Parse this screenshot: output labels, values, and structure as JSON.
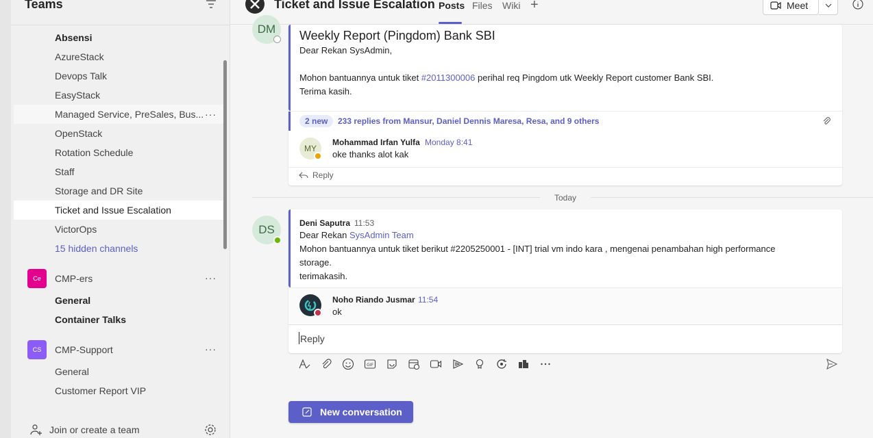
{
  "sidebar": {
    "title": "Teams",
    "channels_team1": [
      {
        "label": "Absensi",
        "bold": true
      },
      {
        "label": "AzureStack"
      },
      {
        "label": "Devops Talk"
      },
      {
        "label": "EasyStack"
      },
      {
        "label": "Managed Service, PreSales, Bus..."
      },
      {
        "label": "OpenStack"
      },
      {
        "label": "Rotation Schedule"
      },
      {
        "label": "Staff"
      },
      {
        "label": "Storage and DR Site"
      },
      {
        "label": "Ticket and Issue Escalation"
      },
      {
        "label": "VictorOps"
      },
      {
        "label": "15 hidden channels"
      }
    ],
    "team_cmp_ers": {
      "initials": "Ce",
      "name": "CMP-ers",
      "color": "#e3008c"
    },
    "cmp_ers_channels": [
      "General",
      "Container Talks"
    ],
    "team_cmp_support": {
      "initials": "CS",
      "name": "CMP-Support",
      "color": "#8b5cf6"
    },
    "cmp_support_channels": [
      "General",
      "Customer Report VIP"
    ],
    "join_label": "Join or create a team",
    "more": "···"
  },
  "header": {
    "channel_title": "Ticket and Issue Escalation",
    "tabs": {
      "posts": "Posts",
      "files": "Files",
      "wiki": "Wiki",
      "add": "+"
    },
    "meet_label": "Meet"
  },
  "thread1": {
    "avatar": "DM",
    "title": "Weekly Report (Pingdom) Bank SBI",
    "line1": "Dear Rekan SysAdmin,",
    "line2_pre": "Mohon bantuannya untuk tiket ",
    "line2_ticket": "#2011300006",
    "line2_post": " perihal req Pingdom utk Weekly Report customer Bank SBI.",
    "line3": "Terima kasih.",
    "new_badge": "2 new",
    "replies_summary": "233 replies from Mansur, Daniel Dennis Maresa, Resa, and 9 others",
    "reply_avatar": "MY",
    "reply_author": "Mohammad Irfan Yulfa",
    "reply_time": "Monday 8:41",
    "reply_text": "oke thanks alot kak",
    "reply_button": "Reply"
  },
  "day_separator": "Today",
  "thread2": {
    "avatar": "DS",
    "author": "Deni Saputra",
    "time": "11:53",
    "line1_pre": "Dear Rekan ",
    "line1_mention": "SysAdmin Team",
    "line2": "Mohon bantuannya untuk tiket berikut #2205250001 - [INT] trial vm indo kara , mengenai penambahan high performance",
    "line3": "storage.",
    "line4": "terimakasih.",
    "reply_author": "Noho Riando Jusmar",
    "reply_time": "11:54",
    "reply_text": "ok",
    "reply_placeholder": "Reply"
  },
  "compose_tools": [
    "format-icon",
    "attach-icon",
    "emoji-icon",
    "gif-icon",
    "sticker-icon",
    "schedule-meeting-icon",
    "video-icon",
    "stream-icon",
    "praise-icon",
    "loop-icon",
    "onenote-icon",
    "more-icon"
  ],
  "new_conversation_label": "New conversation",
  "colors": {
    "accent": "#5b5fc7",
    "online": "#6bb700",
    "away": "#eaa300",
    "busy": "#c4314b"
  }
}
